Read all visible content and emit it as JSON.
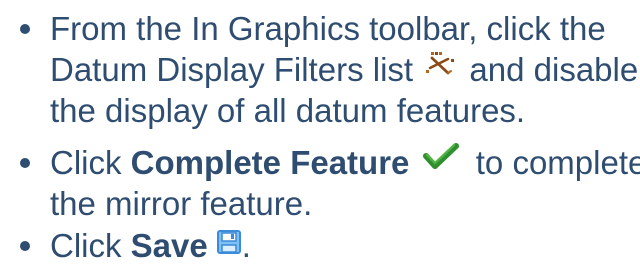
{
  "instructions": [
    {
      "line1": "From the In Graphics toolbar, click the",
      "line2_before_icon": "Datum Display Filters list",
      "line2_after_icon": "and disable",
      "line3": "the display of all datum features.",
      "icon": "datum-display-filters-icon"
    },
    {
      "line1_prefix": "Click ",
      "line1_bold": "Complete Feature",
      "line1_after_icon": "to complete",
      "line2": "the mirror feature.",
      "icon": "green-checkmark-icon"
    },
    {
      "line1_prefix": "Click ",
      "line1_bold": "Save",
      "line1_suffix": ".",
      "icon": "save-icon"
    }
  ],
  "colors": {
    "text": "#2f4d71",
    "check": "#2f8f2f",
    "save": "#3a8bd9",
    "datum": "#8a4b17"
  }
}
